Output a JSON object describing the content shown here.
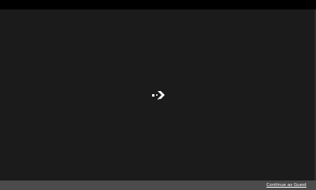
{
  "loading": {
    "icon": "arrow-logo-icon",
    "colors": {
      "background": "#1b1b1b",
      "top_bar": "#000000",
      "bottom_bar": "#4b4b4b",
      "icon": "#ffffff"
    }
  },
  "footer": {
    "guest_link_label": "Continue as Guest"
  }
}
